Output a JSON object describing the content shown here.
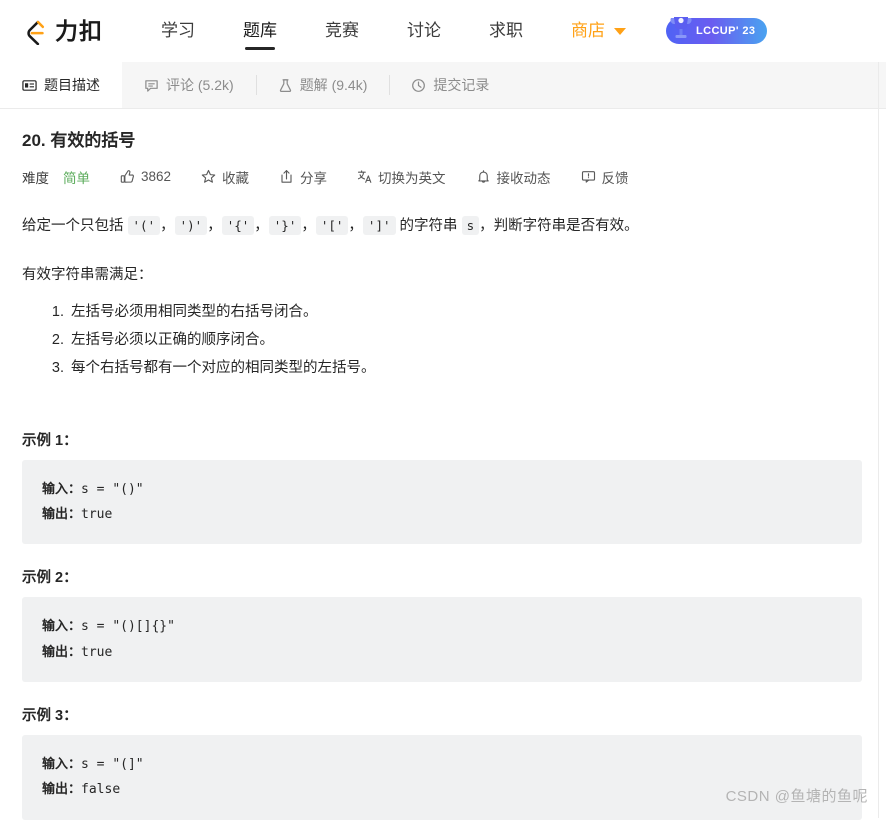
{
  "brand": {
    "logo_icon": "leetcode-logo-icon",
    "name": "力扣"
  },
  "nav": {
    "items": [
      {
        "label": "学习",
        "active": false
      },
      {
        "label": "题库",
        "active": true
      },
      {
        "label": "竞赛",
        "active": false
      },
      {
        "label": "讨论",
        "active": false
      },
      {
        "label": "求职",
        "active": false
      },
      {
        "label": "商店",
        "active": false,
        "dropdown": true
      }
    ],
    "badge": {
      "text": "LCCUP' 23",
      "icon": "trophy-icon"
    }
  },
  "tabs": [
    {
      "label": "题目描述",
      "icon": "description-icon",
      "active": true
    },
    {
      "label": "评论 (5.2k)",
      "icon": "comment-icon",
      "active": false
    },
    {
      "label": "题解 (9.4k)",
      "icon": "flask-icon",
      "active": false
    },
    {
      "label": "提交记录",
      "icon": "clock-icon",
      "active": false
    }
  ],
  "problem": {
    "title": "20. 有效的括号",
    "difficulty_label": "难度",
    "difficulty_value": "简单",
    "likes": "3862",
    "favorite_label": "收藏",
    "share_label": "分享",
    "translate_label": "切换为英文",
    "subscribe_label": "接收动态",
    "feedback_label": "反馈"
  },
  "description": {
    "prefix": "给定一个只包括 ",
    "codes": [
      "'('",
      "')'",
      "'{'",
      "'}'",
      "'['",
      "']'"
    ],
    "separator": "，",
    "middle": " 的字符串 ",
    "var_code": "s",
    "suffix": "，判断字符串是否有效。",
    "rules_heading": "有效字符串需满足：",
    "rules": [
      "左括号必须用相同类型的右括号闭合。",
      "左括号必须以正确的顺序闭合。",
      "每个右括号都有一个对应的相同类型的左括号。"
    ]
  },
  "examples": [
    {
      "title": "示例 1：",
      "input_label": "输入：",
      "input_value": "s = \"()\"",
      "output_label": "输出：",
      "output_value": "true"
    },
    {
      "title": "示例 2：",
      "input_label": "输入：",
      "input_value": "s = \"()[]{}\"",
      "output_label": "输出：",
      "output_value": "true"
    },
    {
      "title": "示例 3：",
      "input_label": "输入：",
      "input_value": "s = \"(]\"",
      "output_label": "输出：",
      "output_value": "false"
    }
  ],
  "watermark": "CSDN @鱼塘的鱼呢",
  "colors": {
    "accent_orange": "#ffa116",
    "difficulty_green": "#5aab5a",
    "code_bg": "#f0f1f2",
    "tabbar_bg": "#f6f6f6"
  }
}
